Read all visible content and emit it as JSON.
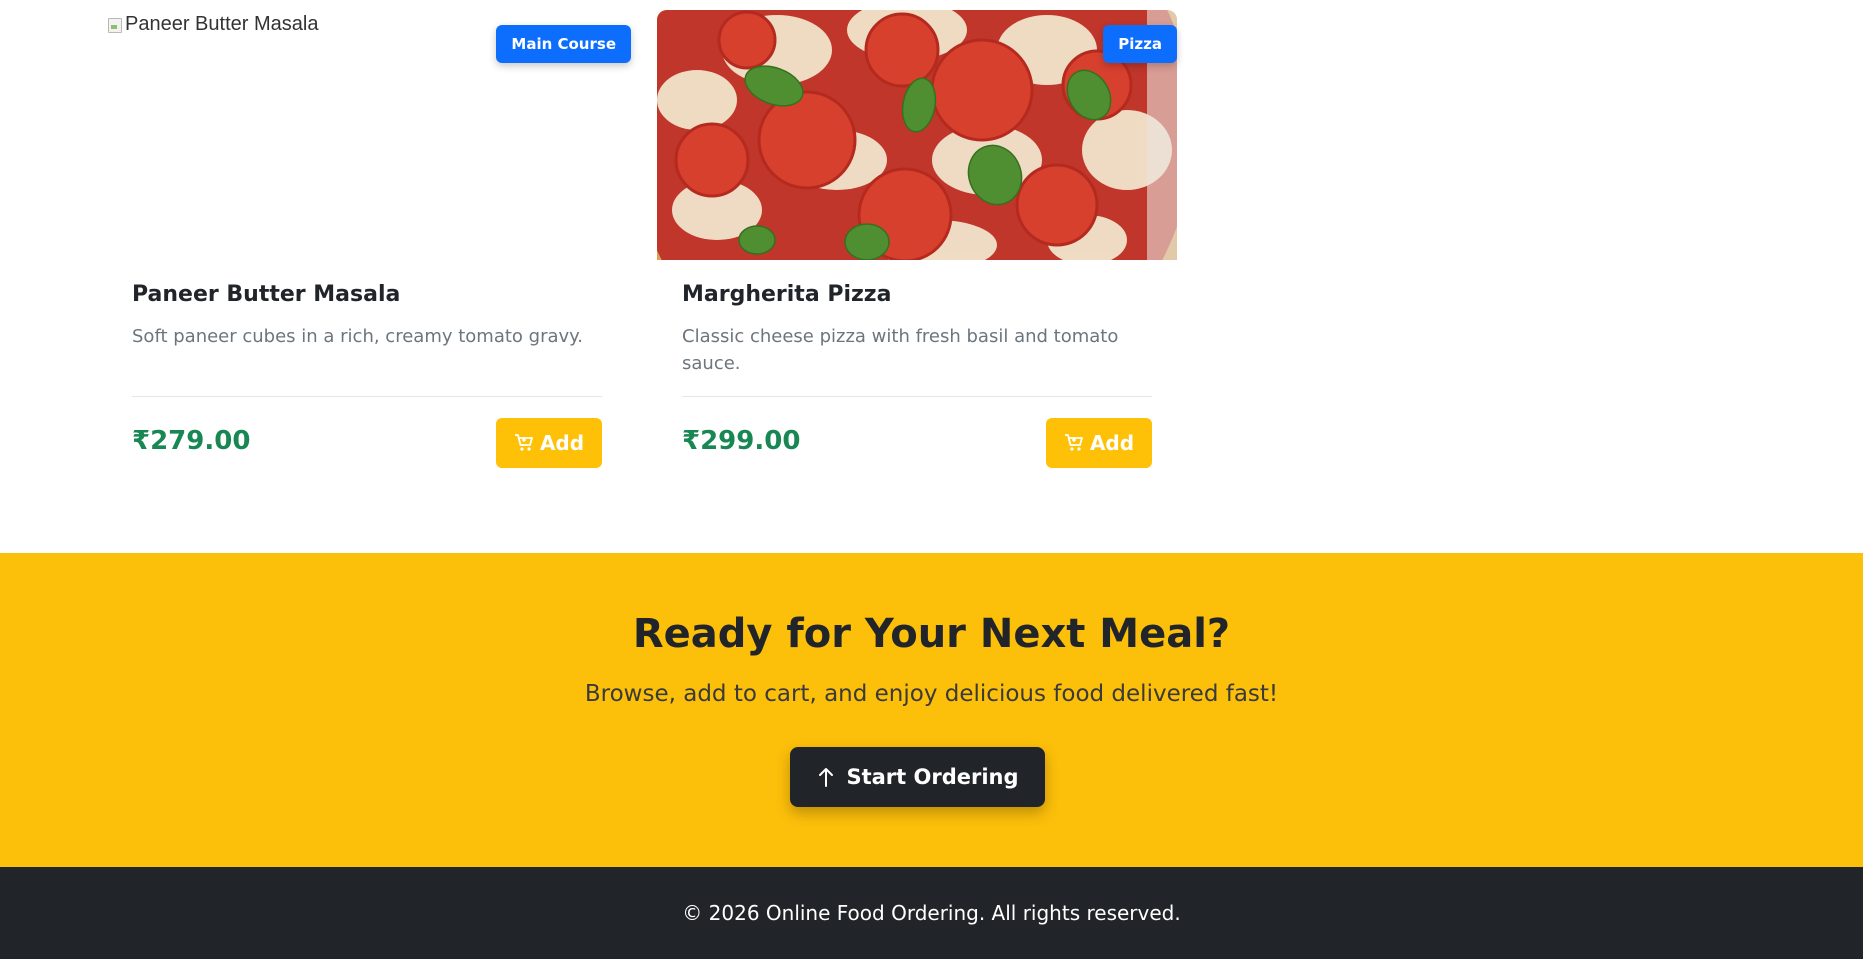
{
  "products": [
    {
      "image_alt": "Paneer Butter Masala",
      "category": "Main Course",
      "name": "Paneer Butter Masala",
      "description": "Soft paneer cubes in a rich, creamy tomato gravy.",
      "price": "₹279.00",
      "add_label": "Add"
    },
    {
      "image_alt": "Margherita Pizza",
      "category": "Pizza",
      "name": "Margherita Pizza",
      "description": "Classic cheese pizza with fresh basil and tomato sauce.",
      "price": "₹299.00",
      "add_label": "Add"
    }
  ],
  "cta": {
    "title": "Ready for Your Next Meal?",
    "subtitle": "Browse, add to cart, and enjoy delicious food delivered fast!",
    "button_label": "Start Ordering"
  },
  "footer": {
    "text": "© 2026 Online Food Ordering. All rights reserved."
  },
  "colors": {
    "badge": "#0d6efd",
    "add_button": "#ffc107",
    "price": "#198754",
    "cta_background": "#fcbf0a",
    "footer_background": "#212529"
  }
}
